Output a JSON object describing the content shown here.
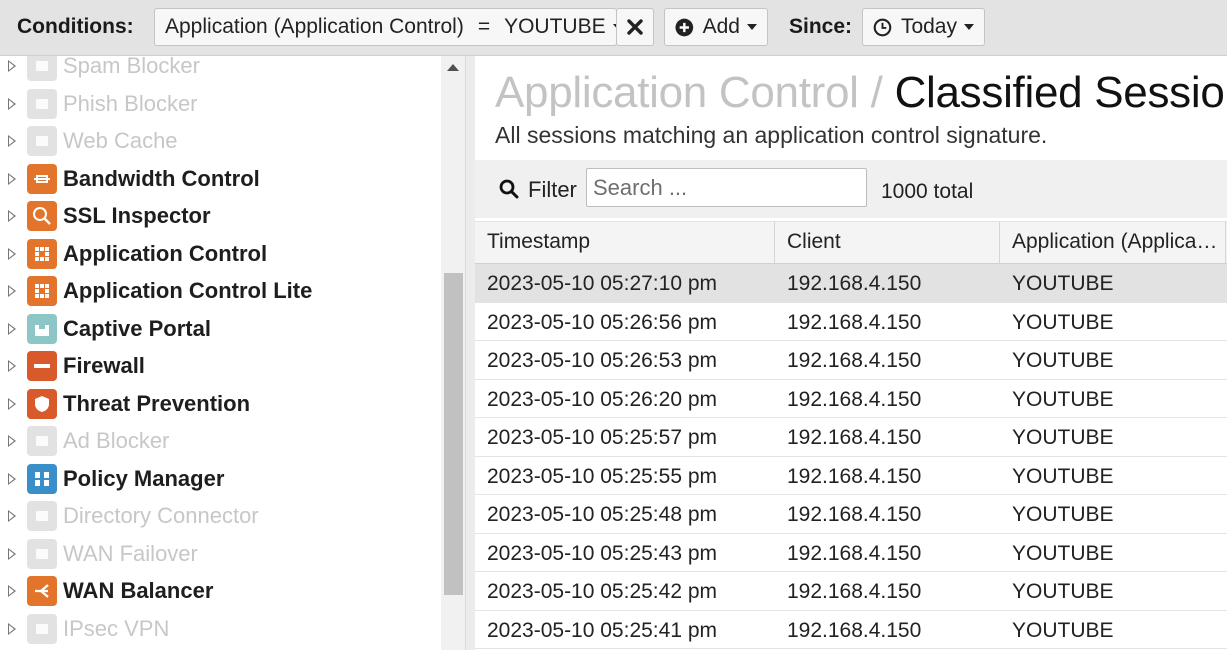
{
  "conditions": {
    "label": "Conditions:",
    "condition_text": "Application (Application Control)",
    "operator": "=",
    "value": "YOUTUBE",
    "add_label": "Add",
    "since_label": "Since:",
    "since_value": "Today"
  },
  "sidebar": {
    "items": [
      {
        "label": "Spam Blocker",
        "enabled": false,
        "icon": "spam-blocker-icon"
      },
      {
        "label": "Phish Blocker",
        "enabled": false,
        "icon": "phish-blocker-icon"
      },
      {
        "label": "Web Cache",
        "enabled": false,
        "icon": "web-cache-icon"
      },
      {
        "label": "Bandwidth Control",
        "enabled": true,
        "icon": "bandwidth-control-icon"
      },
      {
        "label": "SSL Inspector",
        "enabled": true,
        "icon": "ssl-inspector-icon"
      },
      {
        "label": "Application Control",
        "enabled": true,
        "icon": "application-control-icon"
      },
      {
        "label": "Application Control Lite",
        "enabled": true,
        "icon": "application-control-lite-icon"
      },
      {
        "label": "Captive Portal",
        "enabled": true,
        "icon": "captive-portal-icon"
      },
      {
        "label": "Firewall",
        "enabled": true,
        "icon": "firewall-icon"
      },
      {
        "label": "Threat Prevention",
        "enabled": true,
        "icon": "threat-prevention-icon"
      },
      {
        "label": "Ad Blocker",
        "enabled": false,
        "icon": "ad-blocker-icon"
      },
      {
        "label": "Policy Manager",
        "enabled": true,
        "icon": "policy-manager-icon"
      },
      {
        "label": "Directory Connector",
        "enabled": false,
        "icon": "directory-connector-icon"
      },
      {
        "label": "WAN Failover",
        "enabled": false,
        "icon": "wan-failover-icon"
      },
      {
        "label": "WAN Balancer",
        "enabled": true,
        "icon": "wan-balancer-icon"
      },
      {
        "label": "IPsec VPN",
        "enabled": false,
        "icon": "ipsec-vpn-icon"
      }
    ]
  },
  "report": {
    "app_title": "Application Control",
    "separator": "/",
    "report_title": "Classified Sessions",
    "description": "All sessions matching an application control signature.",
    "filter_label": "Filter",
    "search_placeholder": "Search ...",
    "total_text": "1000 total",
    "columns": [
      "Timestamp",
      "Client",
      "Application (Applica…"
    ],
    "rows": [
      {
        "timestamp": "2023-05-10 05:27:10 pm",
        "client": "192.168.4.150",
        "application": "YOUTUBE"
      },
      {
        "timestamp": "2023-05-10 05:26:56 pm",
        "client": "192.168.4.150",
        "application": "YOUTUBE"
      },
      {
        "timestamp": "2023-05-10 05:26:53 pm",
        "client": "192.168.4.150",
        "application": "YOUTUBE"
      },
      {
        "timestamp": "2023-05-10 05:26:20 pm",
        "client": "192.168.4.150",
        "application": "YOUTUBE"
      },
      {
        "timestamp": "2023-05-10 05:25:57 pm",
        "client": "192.168.4.150",
        "application": "YOUTUBE"
      },
      {
        "timestamp": "2023-05-10 05:25:55 pm",
        "client": "192.168.4.150",
        "application": "YOUTUBE"
      },
      {
        "timestamp": "2023-05-10 05:25:48 pm",
        "client": "192.168.4.150",
        "application": "YOUTUBE"
      },
      {
        "timestamp": "2023-05-10 05:25:43 pm",
        "client": "192.168.4.150",
        "application": "YOUTUBE"
      },
      {
        "timestamp": "2023-05-10 05:25:42 pm",
        "client": "192.168.4.150",
        "application": "YOUTUBE"
      },
      {
        "timestamp": "2023-05-10 05:25:41 pm",
        "client": "192.168.4.150",
        "application": "YOUTUBE"
      }
    ]
  },
  "colors": {
    "accent_orange": "#e3742c",
    "accent_blue": "#3a8fc9",
    "disabled_text": "#c7c7c7",
    "selected_row": "#e2e2e2"
  }
}
